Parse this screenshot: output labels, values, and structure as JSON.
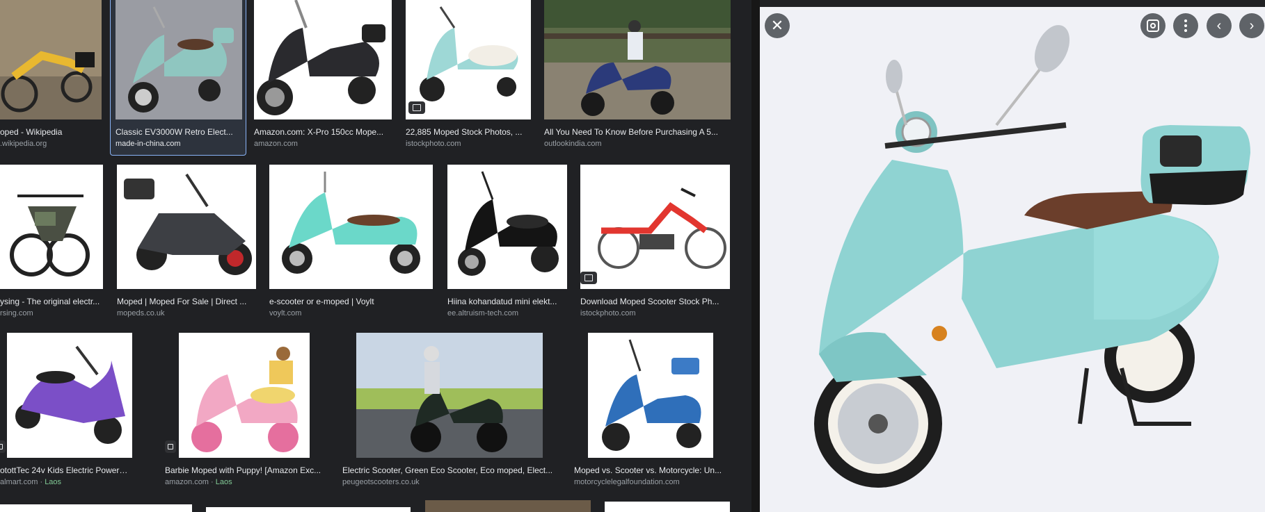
{
  "results": [
    {
      "title": "oped - Wikipedia",
      "source": ".wikipedia.org"
    },
    {
      "title": "Classic EV3000W Retro Elect...",
      "source": "made-in-china.com"
    },
    {
      "title": "Amazon.com: X-Pro 150cc Mope...",
      "source": "amazon.com"
    },
    {
      "title": "22,885 Moped Stock Photos, ...",
      "source": "istockphoto.com"
    },
    {
      "title": "All You Need To Know Before Purchasing A 5...",
      "source": "outlookindia.com"
    },
    {
      "title": "ysing - The original electr...",
      "source": "rsing.com"
    },
    {
      "title": "Moped | Moped For Sale | Direct ...",
      "source": "mopeds.co.uk"
    },
    {
      "title": "e-scooter or e-moped | Voylt",
      "source": "voylt.com"
    },
    {
      "title": "Hiina kohandatud mini elekt...",
      "source": "ee.altruism-tech.com"
    },
    {
      "title": "Download Moped Scooter Stock Ph...",
      "source": "istockphoto.com"
    },
    {
      "title": "otottTec 24v Kids Electric Powered ...",
      "source": "almart.com",
      "extra": "Laos"
    },
    {
      "title": "Barbie Moped with Puppy! [Amazon Exc...",
      "source": "amazon.com",
      "extra": "Laos"
    },
    {
      "title": "Electric Scooter, Green Eco Scooter, Eco moped, Elect...",
      "source": "peugeotscooters.co.uk"
    },
    {
      "title": "Moped vs. Scooter vs. Motorcycle: Un...",
      "source": "motorcyclelegalfoundation.com"
    }
  ],
  "separator": " · ",
  "preview": {
    "close_icon": "close-icon",
    "lens_icon": "lens-icon",
    "more_icon": "more-vert-icon",
    "prev_icon": "chevron-left-icon",
    "next_icon": "chevron-right-icon"
  },
  "colors": {
    "background": "#202124",
    "selected": "#8ab4f8",
    "preview_bg": "#f0f1f6"
  }
}
